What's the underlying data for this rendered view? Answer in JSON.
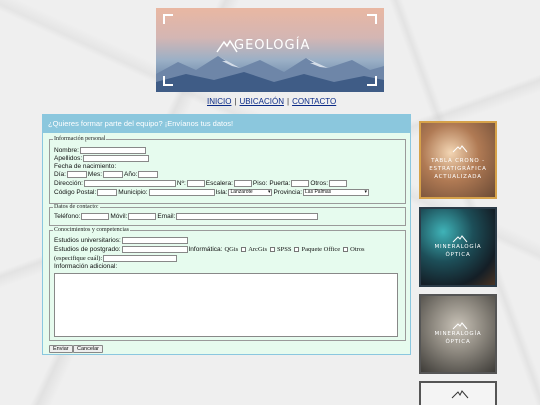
{
  "banner": {
    "logo_text": "GEOLOGÍA"
  },
  "nav": {
    "items": [
      "INICIO",
      "UBICACIÓN",
      "CONTACTO"
    ],
    "separator": "|"
  },
  "form": {
    "header": "¿Quieres formar parte del equipo? ¡Envíanos tus datos!",
    "personal": {
      "legend": "Información personal",
      "nombre": "Nombre:",
      "apellidos": "Apellidos:",
      "fecha": "Fecha de nacimiento:",
      "dia": "Día:",
      "mes": "Mes:",
      "ano": "Año:",
      "direccion": "Dirección:",
      "numero": "Nº:",
      "escalera": "Escalera:",
      "piso": "Piso:",
      "puerta": "Puerta:",
      "otros": "Otros:",
      "cp": "Código Postal:",
      "municipio": "Municipio:",
      "isla": "Isla:",
      "isla_value": "Lanzarote",
      "provincia": "Provincia:",
      "provincia_value": "Las Palmas"
    },
    "contacto": {
      "legend": "Datos de contacto:",
      "telefono": "Teléfono:",
      "movil": "Móvil:",
      "email": "Email:"
    },
    "conocimientos": {
      "legend": "Conocimientos y competencias",
      "universitarios": "Estudios universitarios:",
      "postgrado": "Estudios de postgrado:",
      "informatica": "Informática:",
      "options": [
        "QGis",
        "ArcGis",
        "SPSS",
        "Paquete Office",
        "Otros"
      ],
      "especifique": "(especifique cuál):",
      "adicional": "Información adicional:"
    },
    "buttons": {
      "enviar": "Enviar",
      "cancelar": "Cancelar"
    }
  },
  "sidebar": {
    "cards": [
      {
        "lines": [
          "TABLA CRONO -",
          "ESTRATIGRÁFICA",
          "ACTUALIZADA"
        ]
      },
      {
        "lines": [
          "MINERALOGÍA",
          "ÓPTICA"
        ]
      },
      {
        "lines": [
          "MINERALOGÍA",
          "ÓPTICA"
        ]
      }
    ]
  }
}
